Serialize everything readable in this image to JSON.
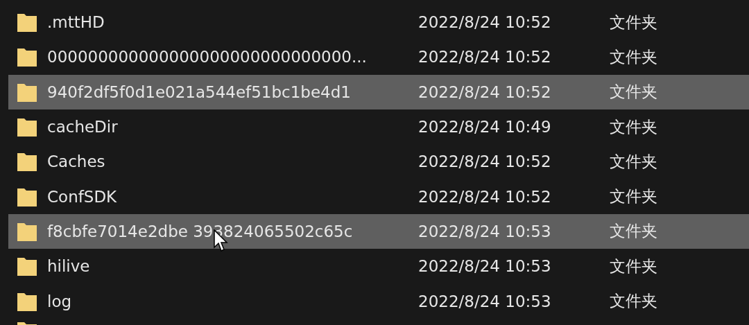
{
  "files": [
    {
      "name": ".mttHD",
      "modified": "2022/8/24 10:52",
      "type": "文件夹",
      "selected": false
    },
    {
      "name": "000000000000000000000000000000...",
      "modified": "2022/8/24 10:52",
      "type": "文件夹",
      "selected": false
    },
    {
      "name": "940f2df5f0d1e021a544ef51bc1be4d1",
      "modified": "2022/8/24 10:52",
      "type": "文件夹",
      "selected": true
    },
    {
      "name": "cacheDir",
      "modified": "2022/8/24 10:49",
      "type": "文件夹",
      "selected": false
    },
    {
      "name": "Caches",
      "modified": "2022/8/24 10:52",
      "type": "文件夹",
      "selected": false
    },
    {
      "name": "ConfSDK",
      "modified": "2022/8/24 10:52",
      "type": "文件夹",
      "selected": false
    },
    {
      "name": "f8cbfe7014e2dbe 393824065502c65c",
      "modified": "2022/8/24 10:53",
      "type": "文件夹",
      "selected": true,
      "pointer": true
    },
    {
      "name": "hilive",
      "modified": "2022/8/24 10:53",
      "type": "文件夹",
      "selected": false
    },
    {
      "name": "log",
      "modified": "2022/8/24 10:53",
      "type": "文件夹",
      "selected": false
    }
  ]
}
